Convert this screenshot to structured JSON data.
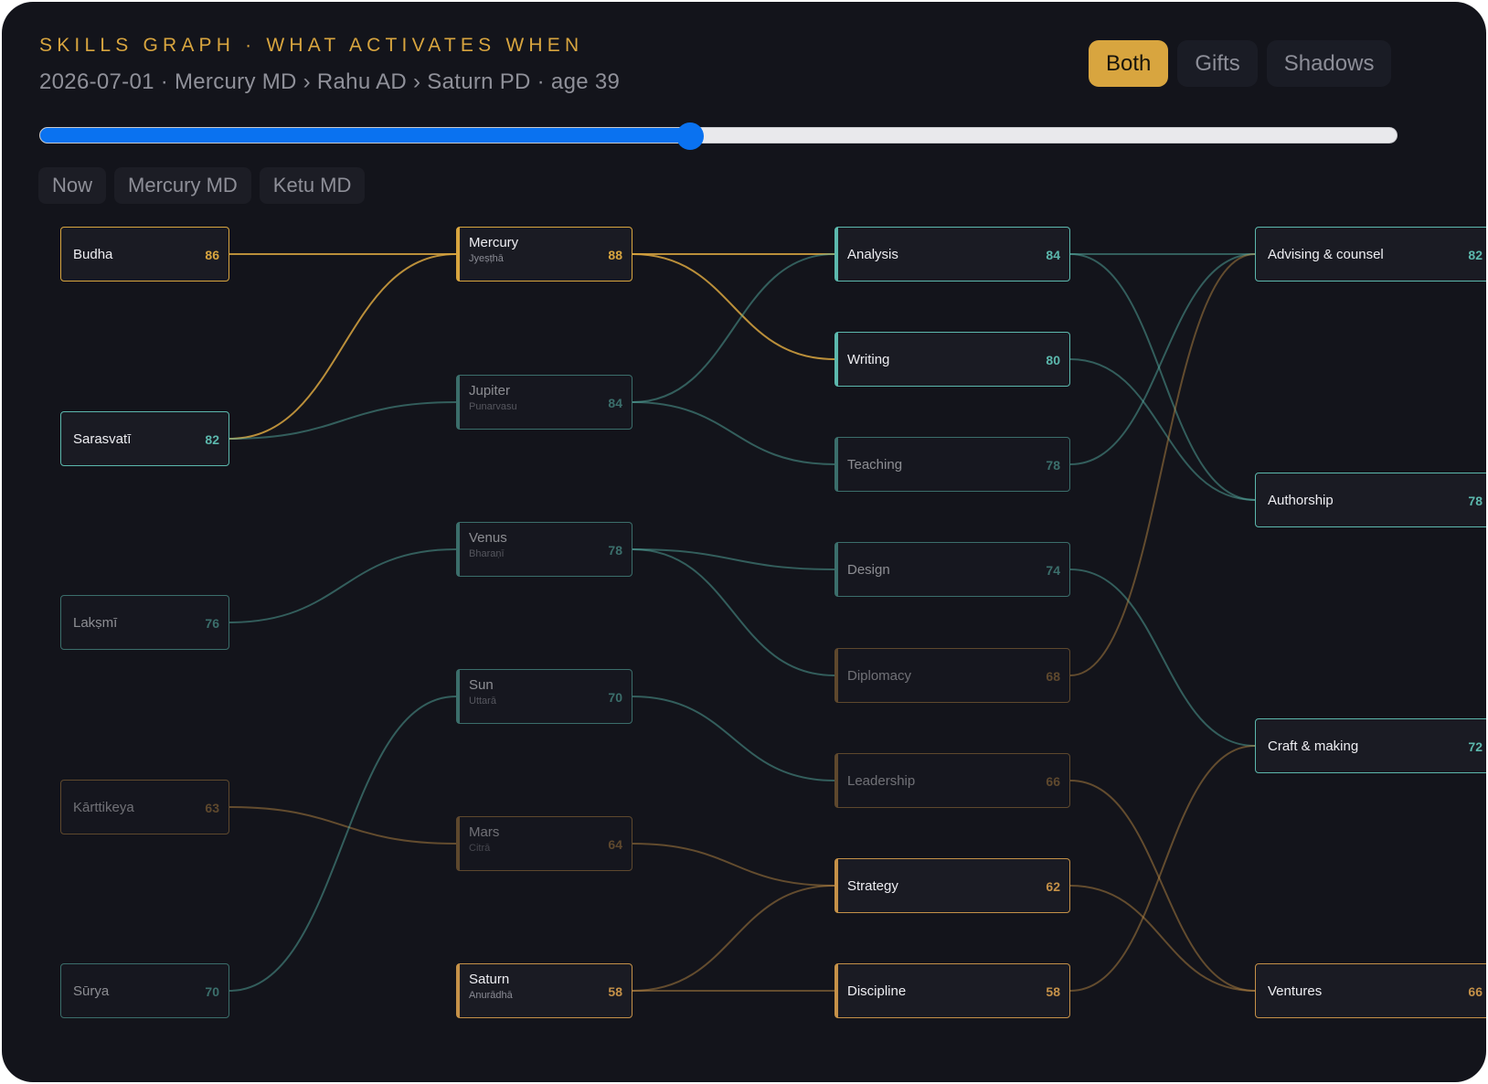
{
  "header": {
    "eyebrow": "SKILLS GRAPH · WHAT ACTIVATES WHEN",
    "subtitle": "2026-07-01 · Mercury MD › Rahu AD › Saturn PD · age 39"
  },
  "modes": {
    "options": [
      "Both",
      "Gifts",
      "Shadows"
    ],
    "selected": "Both"
  },
  "timeline": {
    "position_fraction": 0.479
  },
  "jumps": [
    "Now",
    "Mercury MD",
    "Ketu MD"
  ],
  "colors": {
    "gift": "#5cb8ad",
    "shadow": "#c59148",
    "highlight": "#d8a53f",
    "accent": "#0a72f0"
  },
  "graph": {
    "deities": [
      {
        "id": "budha",
        "name": "Budha",
        "score": "86",
        "tone": "gold",
        "state": "on"
      },
      {
        "id": "sarasvati",
        "name": "Sarasvatī",
        "score": "82",
        "tone": "teal",
        "state": "on"
      },
      {
        "id": "lakshmi",
        "name": "Lakṣmī",
        "score": "76",
        "tone": "teal",
        "state": "dim"
      },
      {
        "id": "karttikeya",
        "name": "Kārttikeya",
        "score": "63",
        "tone": "brown",
        "state": "dim"
      },
      {
        "id": "surya",
        "name": "Sūrya",
        "score": "70",
        "tone": "teal",
        "state": "dim"
      }
    ],
    "planets": [
      {
        "id": "mercury",
        "name": "Mercury",
        "sub": "Jyeṣṭhā",
        "score": "88",
        "tone": "gold",
        "state": "on"
      },
      {
        "id": "jupiter",
        "name": "Jupiter",
        "sub": "Punarvasu",
        "score": "84",
        "tone": "teal",
        "state": "dim"
      },
      {
        "id": "venus",
        "name": "Venus",
        "sub": "Bharaṇī",
        "score": "78",
        "tone": "teal",
        "state": "dim"
      },
      {
        "id": "sun",
        "name": "Sun",
        "sub": "Uttarā",
        "score": "70",
        "tone": "teal",
        "state": "dim"
      },
      {
        "id": "mars",
        "name": "Mars",
        "sub": "Citrā",
        "score": "64",
        "tone": "brown",
        "state": "dim"
      },
      {
        "id": "saturn",
        "name": "Saturn",
        "sub": "Anurādhā",
        "score": "58",
        "tone": "brown",
        "state": "on"
      }
    ],
    "skills": [
      {
        "id": "analysis",
        "name": "Analysis",
        "score": "84",
        "tone": "teal",
        "state": "on"
      },
      {
        "id": "writing",
        "name": "Writing",
        "score": "80",
        "tone": "teal",
        "state": "on"
      },
      {
        "id": "teaching",
        "name": "Teaching",
        "score": "78",
        "tone": "teal",
        "state": "dim"
      },
      {
        "id": "design",
        "name": "Design",
        "score": "74",
        "tone": "teal",
        "state": "dim"
      },
      {
        "id": "diplomacy",
        "name": "Diplomacy",
        "score": "68",
        "tone": "brown",
        "state": "dim"
      },
      {
        "id": "leadership",
        "name": "Leadership",
        "score": "66",
        "tone": "brown",
        "state": "dim"
      },
      {
        "id": "strategy",
        "name": "Strategy",
        "score": "62",
        "tone": "brown",
        "state": "on"
      },
      {
        "id": "discipline",
        "name": "Discipline",
        "score": "58",
        "tone": "brown",
        "state": "on"
      }
    ],
    "domains": [
      {
        "id": "advising",
        "name": "Advising & counsel",
        "score": "82",
        "tone": "teal",
        "state": "on"
      },
      {
        "id": "authorship",
        "name": "Authorship",
        "score": "78",
        "tone": "teal",
        "state": "on"
      },
      {
        "id": "craft",
        "name": "Craft & making",
        "score": "72",
        "tone": "teal",
        "state": "on"
      },
      {
        "id": "ventures",
        "name": "Ventures",
        "score": "66",
        "tone": "brown",
        "state": "on"
      }
    ],
    "links": [
      {
        "from": "budha",
        "to": "mercury",
        "kind": "gold"
      },
      {
        "from": "sarasvati",
        "to": "mercury",
        "kind": "gold"
      },
      {
        "from": "sarasvati",
        "to": "jupiter",
        "kind": "teal"
      },
      {
        "from": "lakshmi",
        "to": "venus",
        "kind": "teal"
      },
      {
        "from": "karttikeya",
        "to": "mars",
        "kind": "brown"
      },
      {
        "from": "surya",
        "to": "sun",
        "kind": "teal"
      },
      {
        "from": "mercury",
        "to": "analysis",
        "kind": "gold"
      },
      {
        "from": "mercury",
        "to": "writing",
        "kind": "gold"
      },
      {
        "from": "jupiter",
        "to": "analysis",
        "kind": "teal"
      },
      {
        "from": "jupiter",
        "to": "teaching",
        "kind": "teal"
      },
      {
        "from": "venus",
        "to": "design",
        "kind": "teal"
      },
      {
        "from": "venus",
        "to": "diplomacy",
        "kind": "teal"
      },
      {
        "from": "sun",
        "to": "leadership",
        "kind": "teal"
      },
      {
        "from": "mars",
        "to": "strategy",
        "kind": "brown"
      },
      {
        "from": "saturn",
        "to": "strategy",
        "kind": "brown"
      },
      {
        "from": "saturn",
        "to": "discipline",
        "kind": "brown"
      },
      {
        "from": "analysis",
        "to": "advising",
        "kind": "teal"
      },
      {
        "from": "analysis",
        "to": "authorship",
        "kind": "teal"
      },
      {
        "from": "writing",
        "to": "authorship",
        "kind": "teal"
      },
      {
        "from": "teaching",
        "to": "advising",
        "kind": "teal"
      },
      {
        "from": "design",
        "to": "craft",
        "kind": "teal"
      },
      {
        "from": "diplomacy",
        "to": "advising",
        "kind": "brown"
      },
      {
        "from": "leadership",
        "to": "ventures",
        "kind": "brown"
      },
      {
        "from": "strategy",
        "to": "ventures",
        "kind": "brown"
      },
      {
        "from": "discipline",
        "to": "craft",
        "kind": "brown"
      }
    ]
  }
}
